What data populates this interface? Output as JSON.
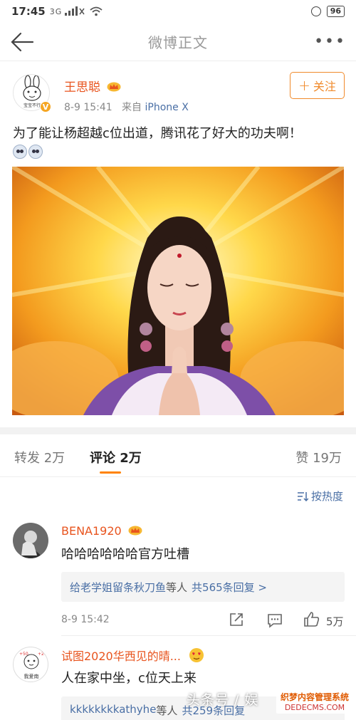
{
  "status_bar": {
    "time": "17:45",
    "network": "3G",
    "battery": "96"
  },
  "nav": {
    "title": "微博正文",
    "more": "•••"
  },
  "post": {
    "author": "王思聪",
    "verified": "V",
    "time": "8-9 15:41",
    "source_prefix": "来自",
    "source": "iPhone X",
    "follow_plus": "+",
    "follow_label": "关注",
    "text": "为了能让杨超越c位出道，腾讯花了好大的功夫啊！",
    "avatar_text": "宝宝不行",
    "image_icon": "praying-girl-photo"
  },
  "tabs": {
    "forward": "转发 2万",
    "comment": "评论 2万",
    "like": "赞 19万"
  },
  "sort_label": "按热度",
  "comments": [
    {
      "name": "BENA1920",
      "text": "哈哈哈哈哈哈官方吐槽",
      "reply_user": "给老学姐留条秋刀鱼",
      "reply_mid": "等人",
      "reply_count": "共565条回复 >",
      "time": "8-9 15:42",
      "likes": "5万"
    },
    {
      "name": "试图2020华西见的晴...",
      "text": "人在家中坐，c位天上来",
      "reply_user": "kkkkkkkkathyhe",
      "reply_mid": "等人",
      "reply_count": "共259条回复",
      "avatar_text": "我爱南"
    }
  ],
  "watermark": {
    "text": "头条号 / 娱",
    "logo_top": "织梦内容管理系统",
    "logo_bottom": "DEDECMS.COM"
  },
  "colors": {
    "accent": "#f08a2b",
    "username": "#e8541e",
    "link": "#4a6fa5",
    "tab_underline": "#ff8200"
  }
}
